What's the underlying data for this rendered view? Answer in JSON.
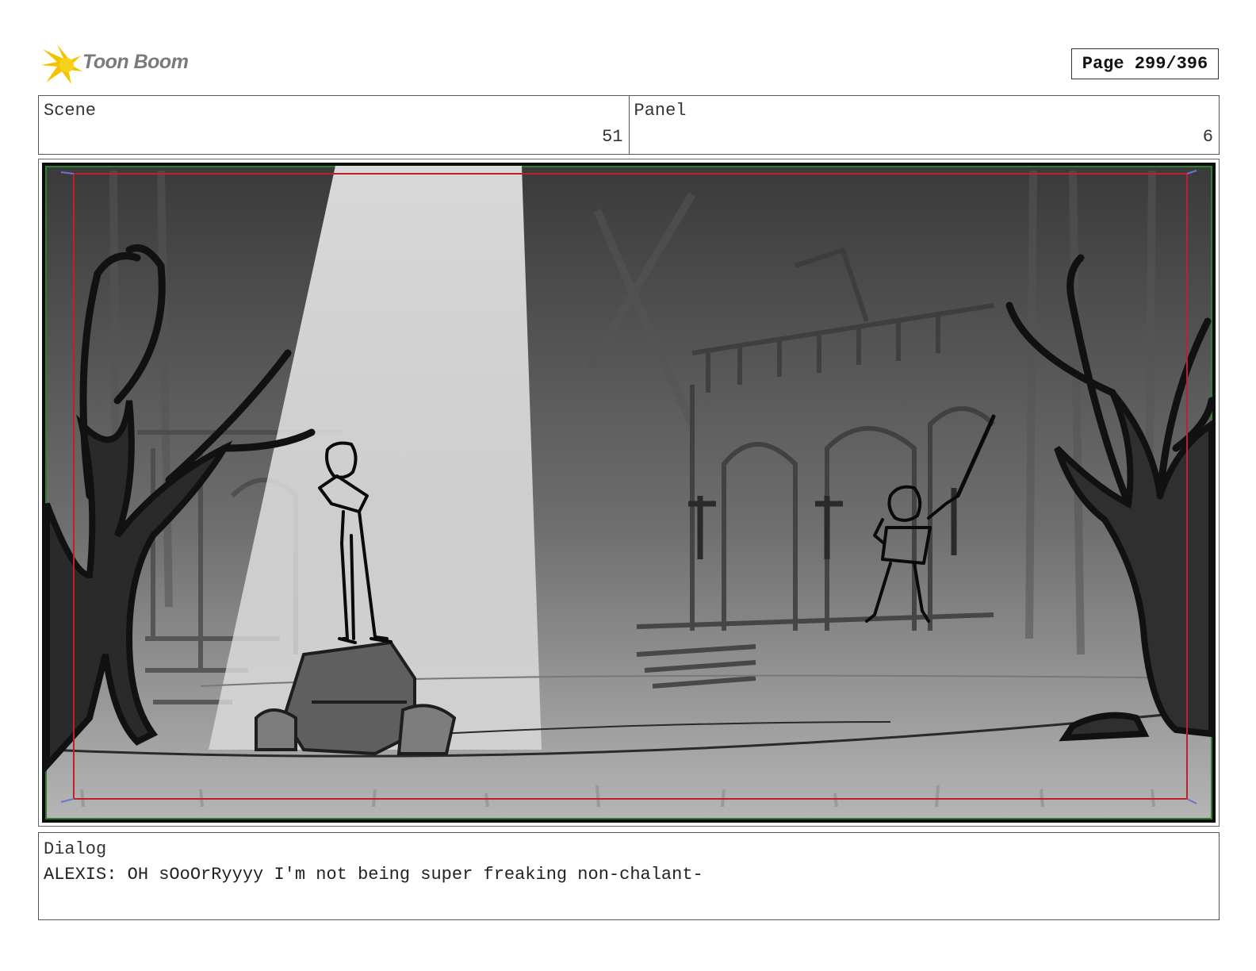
{
  "header": {
    "logo_text": "Toon Boom",
    "page_label": "Page 299/396"
  },
  "scene": {
    "label": "Scene",
    "value": "51"
  },
  "panel": {
    "label": "Panel",
    "value": "6"
  },
  "dialog": {
    "label": "Dialog",
    "text": "ALEXIS: OH sOoOrRyyyy I'm not being super freaking non-chalant-"
  },
  "colors": {
    "logo_yellow": "#f5c400",
    "safe_frame_red": "#c0202a",
    "frame_green": "#2e7d32",
    "drawing_gray": "#8a8a8a"
  }
}
